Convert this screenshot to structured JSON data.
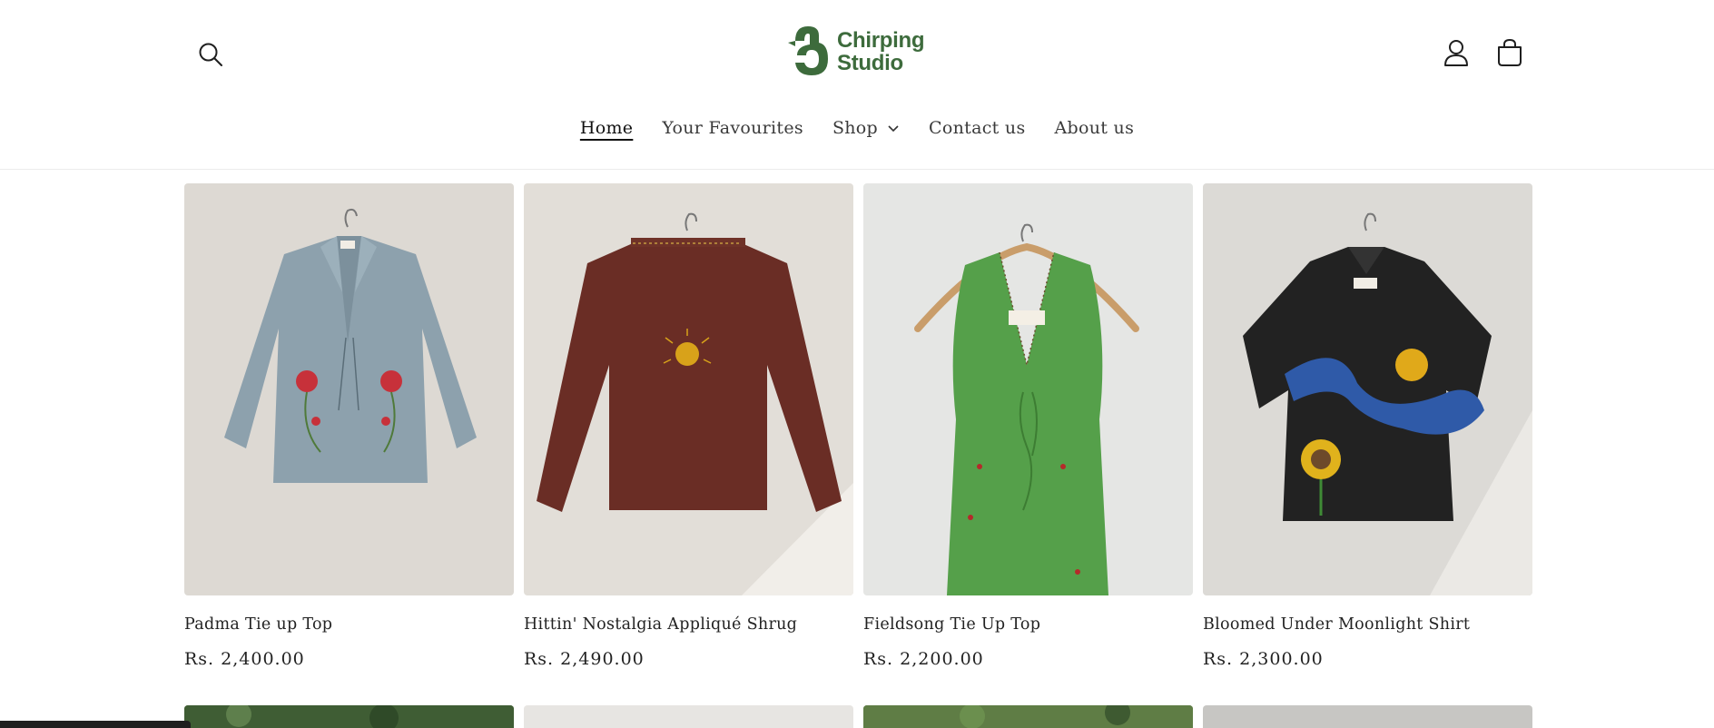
{
  "brand": {
    "name_line1": "Chirping",
    "name_line2": "Studio",
    "color": "#3d6b3c"
  },
  "header": {
    "search_icon": "search-icon",
    "account_icon": "account-icon",
    "cart_icon": "cart-icon"
  },
  "nav": {
    "items": [
      {
        "label": "Home",
        "active": true
      },
      {
        "label": "Your Favourites"
      },
      {
        "label": "Shop",
        "has_dropdown": true
      },
      {
        "label": "Contact us"
      },
      {
        "label": "About us"
      }
    ]
  },
  "products": [
    {
      "title": "Padma Tie up Top",
      "price": "Rs. 2,400.00"
    },
    {
      "title": "Hittin' Nostalgia Appliqué Shrug",
      "price": "Rs. 2,490.00"
    },
    {
      "title": "Fieldsong Tie Up Top",
      "price": "Rs. 2,200.00"
    },
    {
      "title": "Bloomed Under Moonlight Shirt",
      "price": "Rs. 2,300.00"
    }
  ]
}
